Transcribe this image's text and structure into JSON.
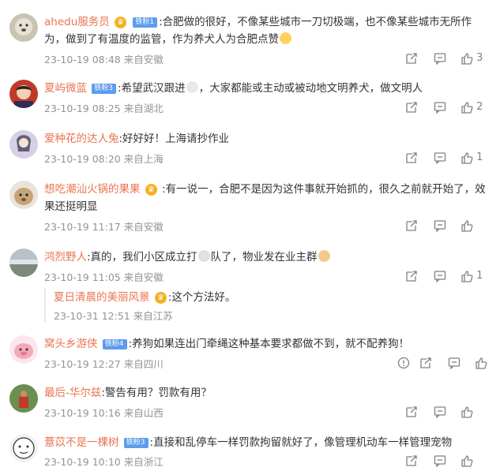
{
  "comments": [
    {
      "name": "ahedu服务员",
      "fan_badge": "铁粉1",
      "text": ":合肥做的很好，不像某些城市一刀切极端，也不像某些城市无所作为，做到了有温度的监管，作为养犬人为合肥点赞",
      "time": "23-10-19 08:48",
      "location": "来自安徽",
      "likes": "3"
    },
    {
      "name": "夏屿微蓝",
      "fan_badge": "铁粉3",
      "text": ":希望武汉跟进",
      "text2": "，大家都能或主动或被动地文明养犬，做文明人",
      "time": "23-10-19 08:25",
      "location": "来自湖北",
      "likes": "2"
    },
    {
      "name": "爱种花的达人兔",
      "text": ":好好好！上海请抄作业",
      "time": "23-10-19 08:20",
      "location": "来自上海",
      "likes": "1"
    },
    {
      "name": "想吃潮汕火锅的果果",
      "text": " :有一说一，合肥不是因为这件事就开始抓的，很久之前就开始了，效果还挺明显",
      "time": "23-10-19 11:17",
      "location": "来自安徽",
      "likes": ""
    },
    {
      "name": "鸿烈野人",
      "text": ":真的，我们小区成立打",
      "text2": "队了，物业发在业主群",
      "time": "23-10-19 11:05",
      "location": "来自安徽",
      "likes": "1",
      "reply": {
        "name": "夏日清晨的美丽风景",
        "text": ":这个方法好。",
        "time": "23-10-31 12:51",
        "location": "来自江苏"
      }
    },
    {
      "name": "窝头乡游侠",
      "fan_badge": "铁粉4",
      "text": ":养狗如果连出门牵绳这种基本要求都做不到，就不配养狗！",
      "time": "23-10-19 12:27",
      "location": "来自四川",
      "likes": ""
    },
    {
      "name": "最后-华尔兹",
      "text": ":警告有用？罚款有用？",
      "time": "23-10-19 10:16",
      "location": "来自山西",
      "likes": ""
    },
    {
      "name": "薏苡不是一棵树",
      "fan_badge": "铁粉3",
      "text": ":直接和乱停车一样罚款拘留就好了，像管理机动车一样管理宠物",
      "time": "23-10-19 10:10",
      "location": "来自浙江",
      "likes": ""
    }
  ],
  "colors": {
    "name": "#eb7350",
    "meta": "#939393",
    "fan_badge": "#5d9cec",
    "crown": "#f6b022"
  }
}
